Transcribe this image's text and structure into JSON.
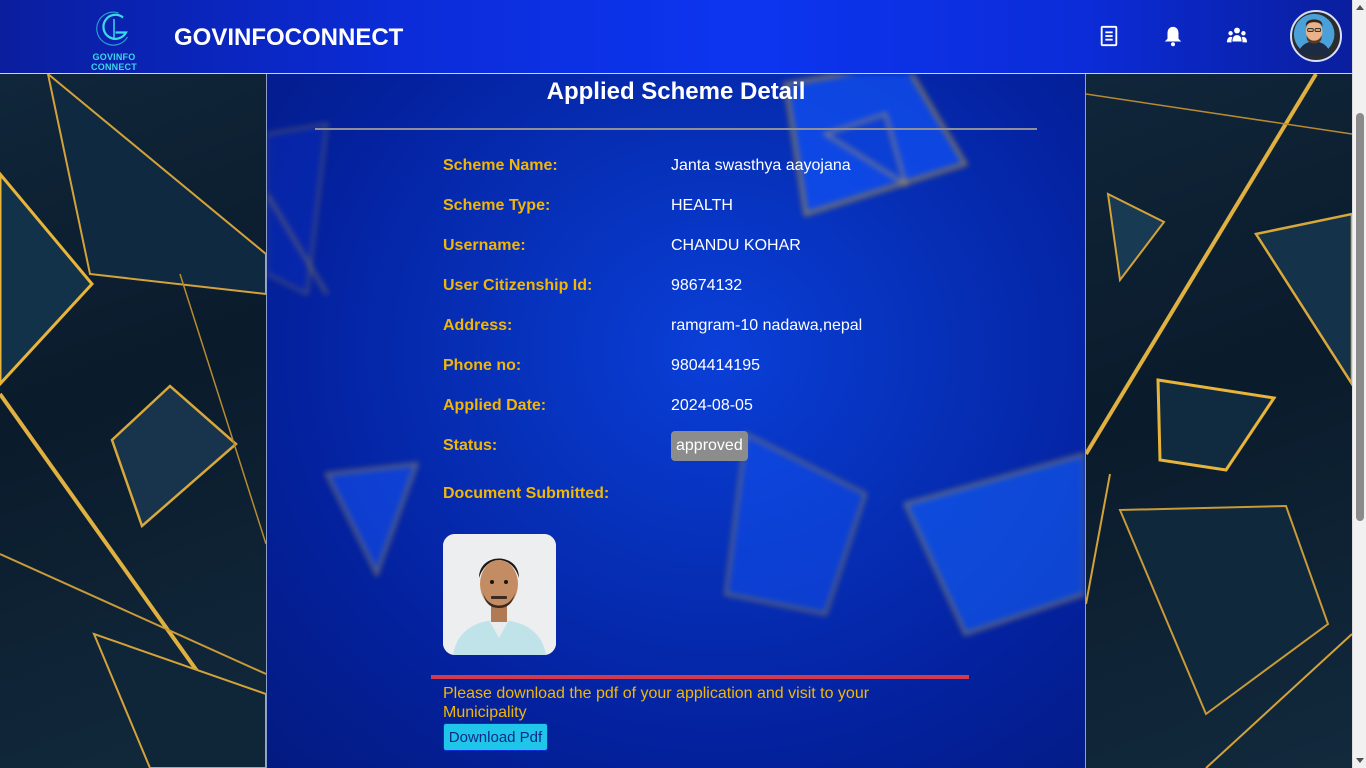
{
  "brand": {
    "logo_text": "GOVINFO CONNECT",
    "title": "GOVINFOCONNECT"
  },
  "header_icons": [
    "document-icon",
    "bell-icon",
    "users-icon",
    "user-avatar"
  ],
  "page": {
    "title": "Applied Scheme Detail"
  },
  "details": [
    {
      "label": "Scheme Name:",
      "value": "Janta swasthya aayojana"
    },
    {
      "label": "Scheme Type:",
      "value": "HEALTH"
    },
    {
      "label": "Username:",
      "value": "CHANDU KOHAR"
    },
    {
      "label": "User Citizenship Id:",
      "value": "98674132"
    },
    {
      "label": "Address:",
      "value": "ramgram-10 nadawa,nepal"
    },
    {
      "label": "Phone no:",
      "value": "9804414195"
    },
    {
      "label": "Applied Date:",
      "value": "2024-08-05"
    }
  ],
  "status": {
    "label": "Status:",
    "value": "approved"
  },
  "documents": {
    "label": "Document Submitted:"
  },
  "notice": "Please download the pdf of your application and visit to your Municipality",
  "download_button": "Download Pdf",
  "colors": {
    "header": "#0b2cd8",
    "label": "#f2b705",
    "status_badge": "#8c8c8c",
    "download_button": "#20c5ea",
    "divider": "#d23b4e"
  }
}
